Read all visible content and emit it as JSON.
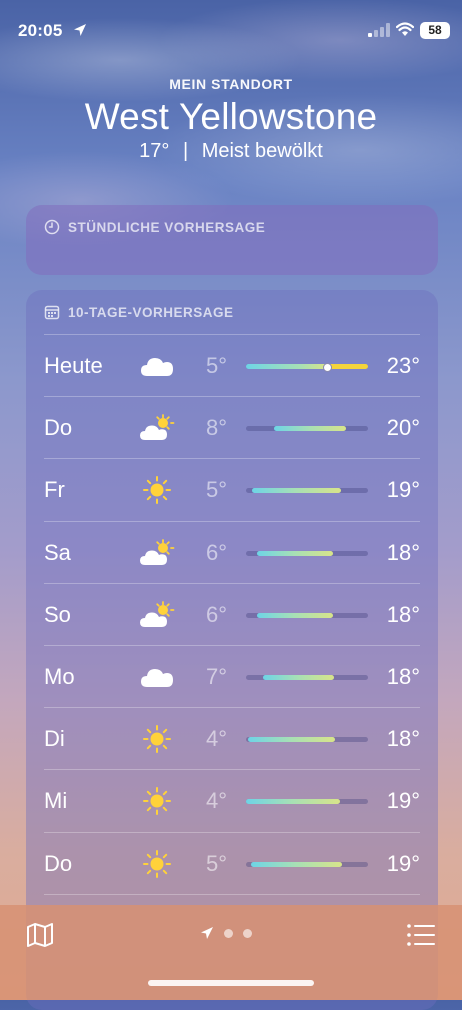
{
  "status_bar": {
    "time": "20:05",
    "battery": "58"
  },
  "header": {
    "subtitle": "MEIN STANDORT",
    "city": "West Yellowstone",
    "temperature": "17°",
    "condition": "Meist bewölkt",
    "separator": "|"
  },
  "hourly": {
    "title": "STÜNDLICHE VORHERSAGE"
  },
  "daily": {
    "title": "10-TAGE-VORHERSAGE",
    "days": [
      {
        "day": "Heute",
        "icon": "cloud-icon",
        "low": "5°",
        "high": "23°"
      },
      {
        "day": "Do",
        "icon": "partly-sunny-icon",
        "low": "8°",
        "high": "20°"
      },
      {
        "day": "Fr",
        "icon": "sun-icon",
        "low": "5°",
        "high": "19°"
      },
      {
        "day": "Sa",
        "icon": "partly-sunny-icon",
        "low": "6°",
        "high": "18°"
      },
      {
        "day": "So",
        "icon": "partly-sunny-icon",
        "low": "6°",
        "high": "18°"
      },
      {
        "day": "Mo",
        "icon": "cloud-icon",
        "low": "7°",
        "high": "18°"
      },
      {
        "day": "Di",
        "icon": "sun-icon",
        "low": "4°",
        "high": "18°"
      },
      {
        "day": "Mi",
        "icon": "sun-icon",
        "low": "4°",
        "high": "19°"
      },
      {
        "day": "Do",
        "icon": "sun-icon",
        "low": "5°",
        "high": "19°"
      }
    ]
  },
  "colors": {
    "sun": "#ffd23a",
    "bar_gradient": [
      "#6ed4e6",
      "#a8e0b4",
      "#d8e48a"
    ],
    "current_segment": "#f4d43a"
  }
}
